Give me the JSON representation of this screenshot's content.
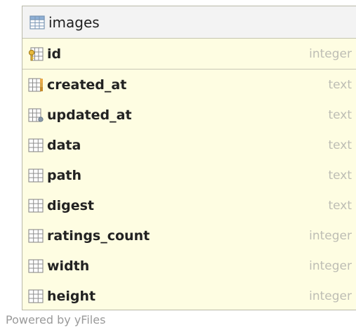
{
  "table": {
    "name": "images",
    "primary_key": {
      "name": "id",
      "type": "integer",
      "icon": "primary-key-column-icon"
    },
    "columns": [
      {
        "name": "created_at",
        "type": "text",
        "icon": "indexed-column-icon"
      },
      {
        "name": "updated_at",
        "type": "text",
        "icon": "indexed-column-icon"
      },
      {
        "name": "data",
        "type": "text",
        "icon": "column-icon"
      },
      {
        "name": "path",
        "type": "text",
        "icon": "column-icon"
      },
      {
        "name": "digest",
        "type": "text",
        "icon": "column-icon"
      },
      {
        "name": "ratings_count",
        "type": "integer",
        "icon": "column-icon"
      },
      {
        "name": "width",
        "type": "integer",
        "icon": "column-icon"
      },
      {
        "name": "height",
        "type": "integer",
        "icon": "column-icon"
      }
    ]
  },
  "footer": {
    "powered_by": "Powered by yFiles"
  },
  "colors": {
    "node_background": "#fefde2",
    "header_background": "#f3f3f3",
    "type_text": "#bdbdb4",
    "icon_grid": "#7a96b4"
  }
}
